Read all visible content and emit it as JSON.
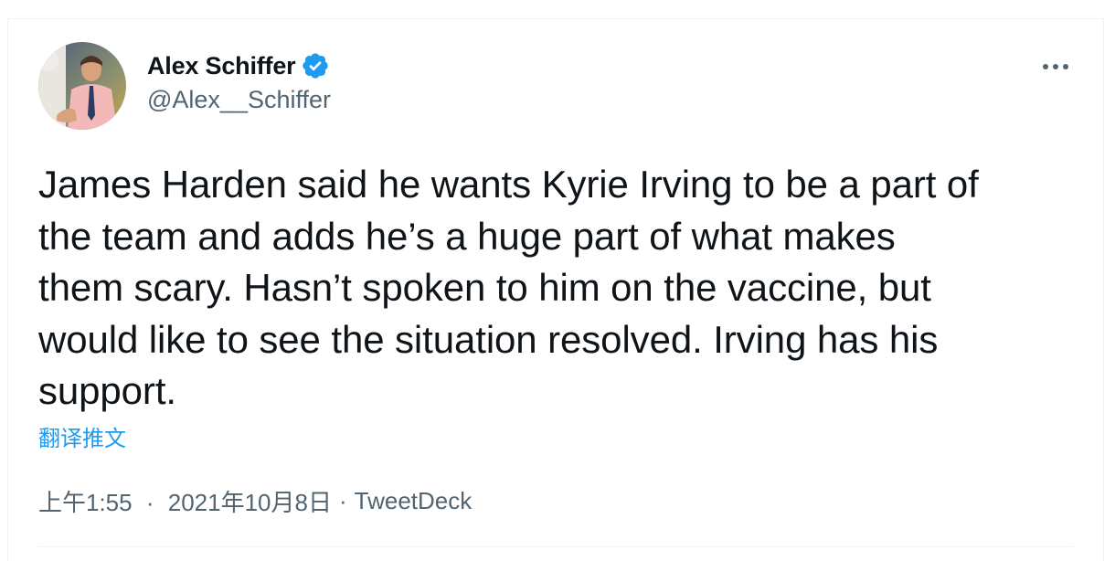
{
  "author": {
    "display_name": "Alex Schiffer",
    "handle": "@Alex__Schiffer",
    "verified": true,
    "avatar": "avatar-photo"
  },
  "tweet": {
    "text": "James Harden said he wants Kyrie Irving to be a part of\nthe team and adds he’s a huge part of what makes\nthem scary. Hasn’t spoken to him on the vaccine, but\nwould like to see the situation resolved. Irving has his\nsupport.",
    "translate_label": "翻译推文",
    "time": "上午1:55",
    "date": "2021年10月8日",
    "separator": "·",
    "source": "TweetDeck"
  },
  "icons": {
    "verified": "verified-badge-icon",
    "more": "more-icon"
  },
  "colors": {
    "accent": "#1d9bf0",
    "text": "#0f1419",
    "secondary": "#536471",
    "border": "#eff3f4"
  }
}
